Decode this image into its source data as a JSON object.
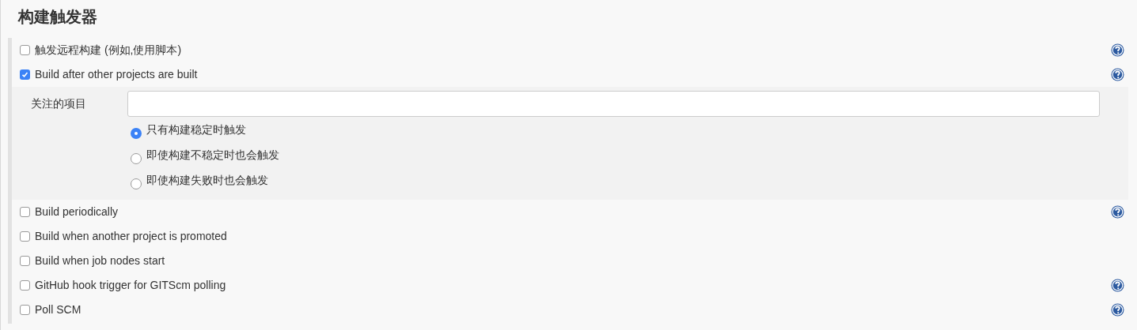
{
  "section": {
    "title": "构建触发器"
  },
  "triggers": [
    {
      "label": "触发远程构建 (例如,使用脚本)",
      "checked": false,
      "help": true
    },
    {
      "label": "Build after other projects are built",
      "checked": true,
      "help": true,
      "config": {
        "field_label": "关注的项目",
        "radios": [
          {
            "label": "只有构建稳定时触发",
            "selected": true
          },
          {
            "label": "即使构建不稳定时也会触发",
            "selected": false
          },
          {
            "label": "即使构建失败时也会触发",
            "selected": false
          }
        ]
      }
    },
    {
      "label": "Build periodically",
      "checked": false,
      "help": true
    },
    {
      "label": "Build when another project is promoted",
      "checked": false,
      "help": false
    },
    {
      "label": "Build when job nodes start",
      "checked": false,
      "help": false
    },
    {
      "label": "GitHub hook trigger for GITScm polling",
      "checked": false,
      "help": true
    },
    {
      "label": "Poll SCM",
      "checked": false,
      "help": true
    }
  ]
}
